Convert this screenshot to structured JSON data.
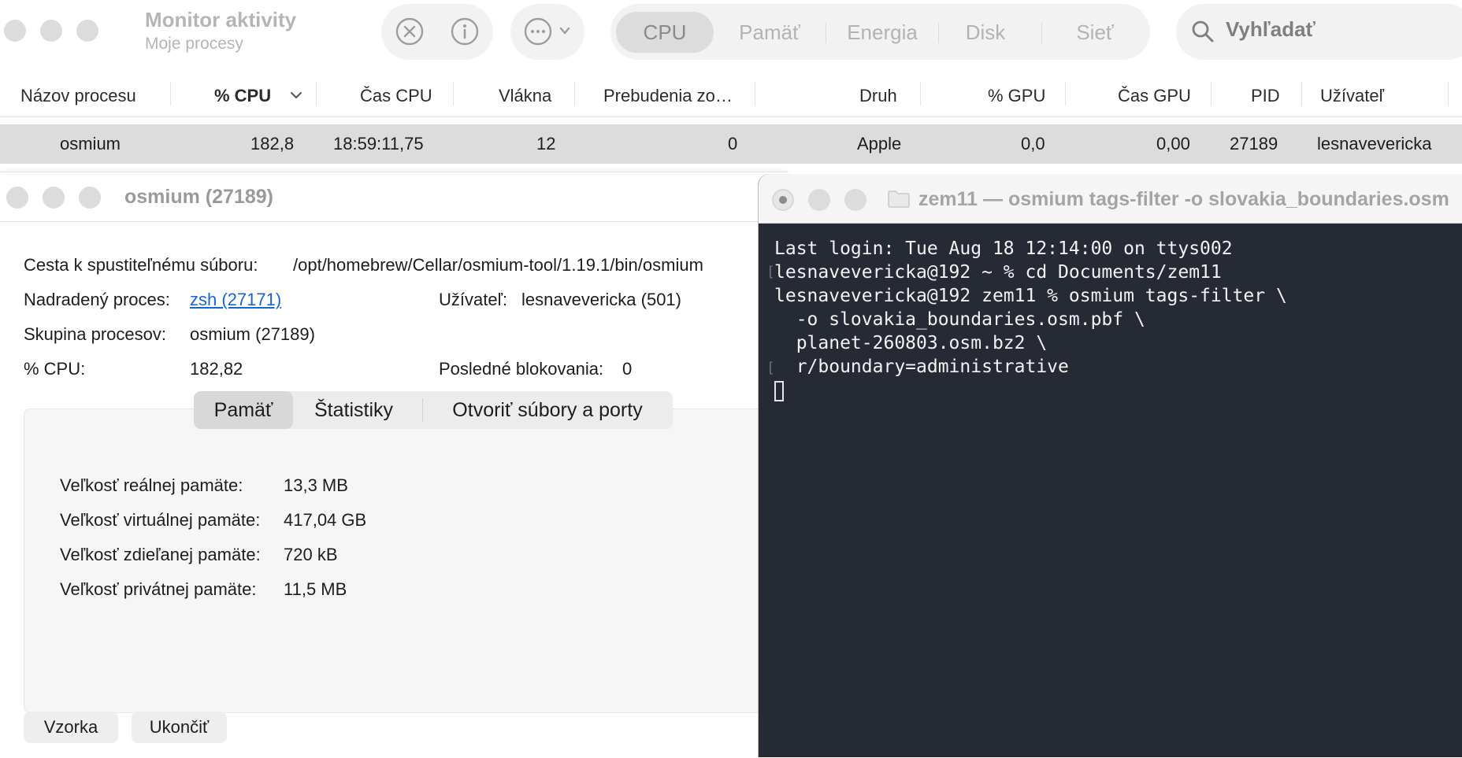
{
  "app": {
    "title": "Monitor aktivity",
    "subtitle": "Moje procesy"
  },
  "toolbar": {
    "stop_icon": "x-circle-icon",
    "info_icon": "info-icon",
    "more_icon": "ellipsis-circle-icon"
  },
  "tabs": [
    {
      "label": "CPU",
      "active": true
    },
    {
      "label": "Pamäť",
      "active": false
    },
    {
      "label": "Energia",
      "active": false
    },
    {
      "label": "Disk",
      "active": false
    },
    {
      "label": "Sieť",
      "active": false
    }
  ],
  "search": {
    "placeholder": "Vyhľadať"
  },
  "columns": [
    "Názov procesu",
    "% CPU",
    "Čas CPU",
    "Vlákna",
    "Prebudenia zo…",
    "Druh",
    "% GPU",
    "Čas GPU",
    "PID",
    "Užívateľ"
  ],
  "selected_row": {
    "name": "osmium",
    "cpu": "182,8",
    "cpu_time": "18:59:11,75",
    "threads": "12",
    "wakeups": "0",
    "kind": "Apple",
    "gpu": "0,0",
    "gpu_time": "0,00",
    "pid": "27189",
    "user": "lesnaveverickа"
  },
  "inspector": {
    "title": "osmium (27189)",
    "path_label": "Cesta k spustiteľnému súboru:",
    "path_value": "/opt/homebrew/Cellar/osmium-tool/1.19.1/bin/osmium",
    "parent_label": "Nadradený proces:",
    "parent_value": "zsh (27171)",
    "user_label": "Užívateľ:",
    "user_value": "lesnaveverickа (501)",
    "group_label": "Skupina procesov:",
    "group_value": "osmium (27189)",
    "cpu_label": "% CPU:",
    "cpu_value": "182,82",
    "blocks_label": "Posledné blokovania:",
    "blocks_value": "0",
    "segments": [
      "Pamäť",
      "Štatistiky",
      "Otvoriť súbory a porty"
    ],
    "memory": [
      {
        "label": "Veľkosť reálnej pamäte:",
        "value": "13,3 MB"
      },
      {
        "label": "Veľkosť virtuálnej pamäte:",
        "value": "417,04 GB"
      },
      {
        "label": "Veľkosť zdieľanej pamäte:",
        "value": "720 kB"
      },
      {
        "label": "Veľkosť privátnej pamäte:",
        "value": "11,5 MB"
      }
    ],
    "sample_button": "Vzorka",
    "quit_button": "Ukončiť"
  },
  "terminal": {
    "title": "zem11 — osmium tags-filter -o slovakia_boundaries.osm",
    "lines": [
      "Last login: Tue Aug 18 12:14:00 on ttys002",
      "lesnaveverickа@192 ~ % cd Documents/zem11",
      "lesnaveverickа@192 zem11 % osmium tags-filter \\",
      "  -o slovakia_boundaries.osm.pbf \\",
      "  planet-260803.osm.bz2 \\",
      "  r/boundary=administrative"
    ]
  }
}
